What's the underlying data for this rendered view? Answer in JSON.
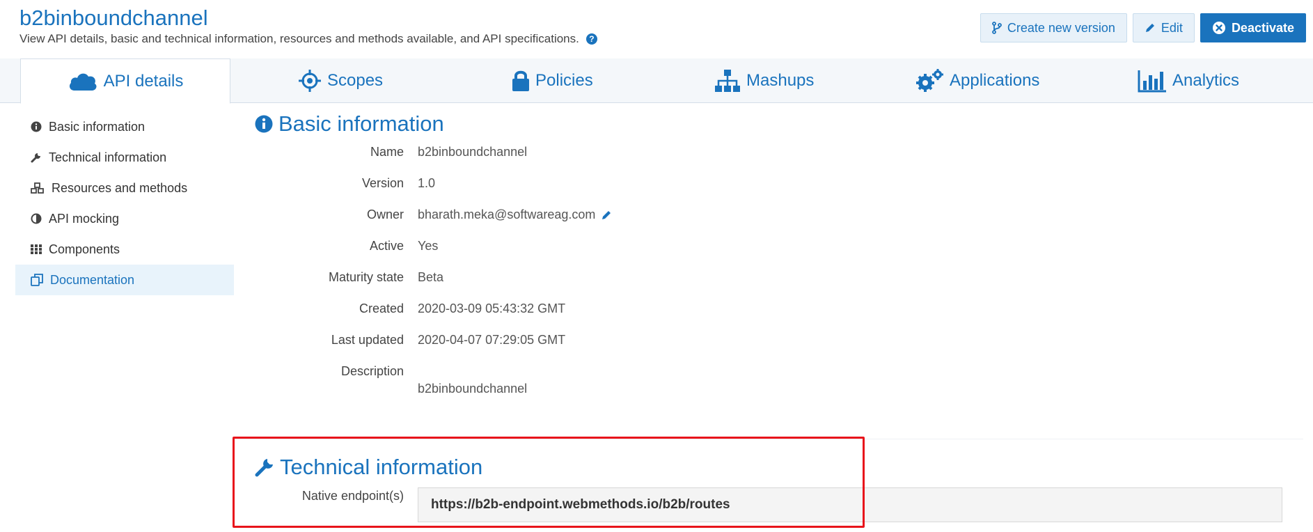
{
  "header": {
    "title": "b2binboundchannel",
    "subtitle": "View API details, basic and technical information, resources and methods available, and API specifications.",
    "help_glyph": "?"
  },
  "actions": {
    "create_version": "Create new version",
    "edit": "Edit",
    "deactivate": "Deactivate"
  },
  "tabs": [
    {
      "label": "API details",
      "icon": "cloud-icon"
    },
    {
      "label": "Scopes",
      "icon": "crosshair-icon"
    },
    {
      "label": "Policies",
      "icon": "lock-icon"
    },
    {
      "label": "Mashups",
      "icon": "sitemap-icon"
    },
    {
      "label": "Applications",
      "icon": "gears-icon"
    },
    {
      "label": "Analytics",
      "icon": "bar-chart-icon"
    }
  ],
  "sidebar": {
    "items": [
      {
        "label": "Basic information",
        "icon": "info-circle-icon"
      },
      {
        "label": "Technical information",
        "icon": "wrench-icon"
      },
      {
        "label": "Resources and methods",
        "icon": "cubes-icon"
      },
      {
        "label": "API mocking",
        "icon": "half-circle-icon"
      },
      {
        "label": "Components",
        "icon": "grid-icon"
      },
      {
        "label": "Documentation",
        "icon": "copy-icon",
        "active": true
      }
    ]
  },
  "basic_info": {
    "title": "Basic information",
    "rows": [
      {
        "label": "Name",
        "value": "b2binboundchannel"
      },
      {
        "label": "Version",
        "value": "1.0"
      },
      {
        "label": "Owner",
        "value": "bharath.meka@softwareag.com"
      },
      {
        "label": "Active",
        "value": "Yes"
      },
      {
        "label": "Maturity state",
        "value": "Beta"
      },
      {
        "label": "Created",
        "value": "2020-03-09 05:43:32 GMT"
      },
      {
        "label": "Last updated",
        "value": "2020-04-07 07:29:05 GMT"
      },
      {
        "label": "Description",
        "value": ""
      }
    ],
    "description_text": "b2binboundchannel"
  },
  "technical_info": {
    "title": "Technical information",
    "endpoint_label": "Native endpoint(s)",
    "endpoint_value": "https://b2b-endpoint.webmethods.io/b2b/routes"
  },
  "colors": {
    "accent": "#1a73bd",
    "highlight": "#e8141b",
    "tab_bar": "#f4f7fa"
  }
}
